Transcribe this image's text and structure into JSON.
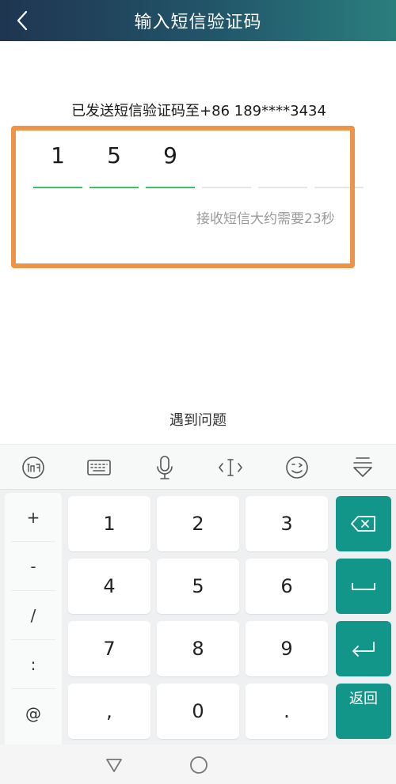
{
  "header": {
    "title": "输入短信验证码"
  },
  "hint": "已发送短信验证码至+86 189****3434",
  "code": {
    "digits": [
      "1",
      "5",
      "9",
      "",
      "",
      ""
    ]
  },
  "timer": "接收短信大约需要23秒",
  "help_link": "遇到问题",
  "colors": {
    "header_start": "#1f3550",
    "header_end": "#2a7f7d",
    "accent_green": "#3cc36a",
    "highlight_orange": "#ee9448",
    "key_teal": "#13968a"
  },
  "toolbar": {
    "icons": [
      "xunfei-logo-icon",
      "keyboard-icon",
      "microphone-icon",
      "cursor-icon",
      "emoji-icon",
      "collapse-keyboard-icon"
    ]
  },
  "keyboard": {
    "symbols": [
      "+",
      "-",
      "/",
      ":",
      "@"
    ],
    "digit_rows": [
      [
        "1",
        "2",
        "3"
      ],
      [
        "4",
        "5",
        "6"
      ],
      [
        "7",
        "8",
        "9"
      ],
      [
        ",",
        "0",
        "."
      ]
    ],
    "function_keys": {
      "return_label": "返回"
    }
  },
  "navbar": {
    "icons": [
      "back-triangle-icon",
      "home-circle-icon"
    ]
  }
}
